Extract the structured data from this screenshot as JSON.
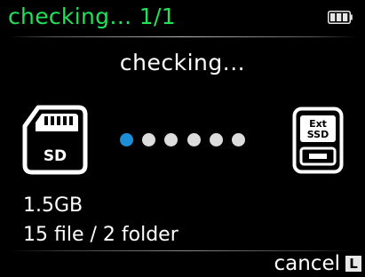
{
  "header": {
    "title": "checking… 1/1",
    "battery_icon": "battery-full-icon"
  },
  "status": {
    "text": "checking..."
  },
  "source": {
    "icon": "sd-card-icon",
    "label": "SD"
  },
  "destination": {
    "icon": "external-ssd-icon",
    "label_line1": "Ext",
    "label_line2": "SSD"
  },
  "progress": {
    "dot_count": 6,
    "active_index": 0,
    "active_color": "#1c8fd8",
    "inactive_color": "#dcdcdc"
  },
  "info": {
    "size": "1.5GB",
    "count": "15 file / 2 folder"
  },
  "footer": {
    "cancel_label": "cancel",
    "cancel_key": "L"
  },
  "colors": {
    "header_text": "#22e05a",
    "background": "#000000",
    "text": "#ffffff"
  }
}
